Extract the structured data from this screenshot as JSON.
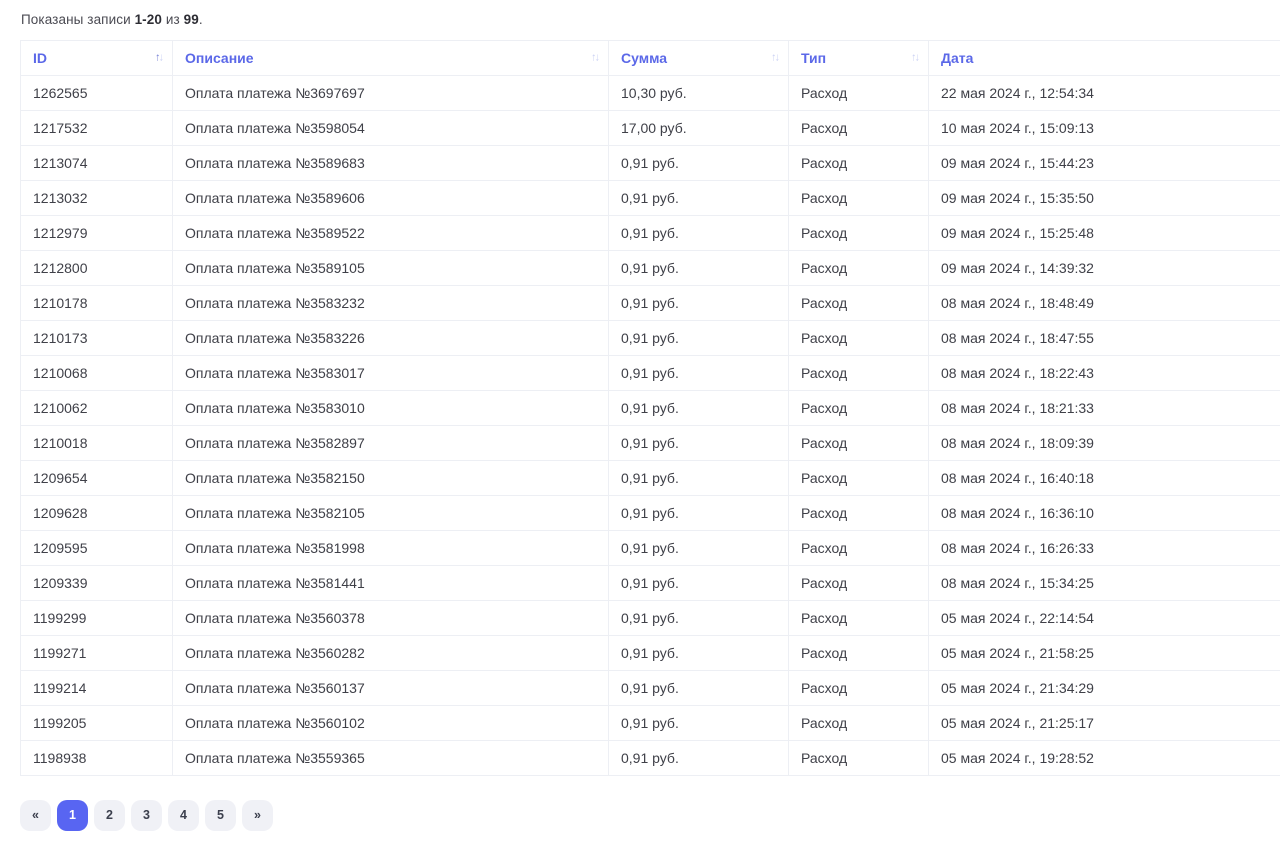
{
  "colors": {
    "accent_header_text": "#5b68e8",
    "active_page_bg": "#5865f2",
    "row_border": "#edeff4",
    "body_text": "#3f4048",
    "inactive_page_bg": "#f0f1f6"
  },
  "icons": {
    "sort_asc": "↑",
    "sort_desc": "↓"
  },
  "summary": {
    "prefix": "Показаны записи",
    "range": "1-20",
    "of_word": "из",
    "total": "99",
    "suffix": "."
  },
  "table": {
    "columns": [
      {
        "key": "id",
        "label": "ID",
        "sort": "asc"
      },
      {
        "key": "description",
        "label": "Описание",
        "sort": "none"
      },
      {
        "key": "amount",
        "label": "Сумма",
        "sort": "none"
      },
      {
        "key": "type",
        "label": "Тип",
        "sort": "none"
      },
      {
        "key": "date",
        "label": "Дата",
        "sort": "none"
      }
    ],
    "rows": [
      {
        "id": "1262565",
        "description": "Оплата платежа №3697697",
        "amount": "10,30 руб.",
        "type": "Расход",
        "date": "22 мая 2024 г., 12:54:34"
      },
      {
        "id": "1217532",
        "description": "Оплата платежа №3598054",
        "amount": "17,00 руб.",
        "type": "Расход",
        "date": "10 мая 2024 г., 15:09:13"
      },
      {
        "id": "1213074",
        "description": "Оплата платежа №3589683",
        "amount": "0,91 руб.",
        "type": "Расход",
        "date": "09 мая 2024 г., 15:44:23"
      },
      {
        "id": "1213032",
        "description": "Оплата платежа №3589606",
        "amount": "0,91 руб.",
        "type": "Расход",
        "date": "09 мая 2024 г., 15:35:50"
      },
      {
        "id": "1212979",
        "description": "Оплата платежа №3589522",
        "amount": "0,91 руб.",
        "type": "Расход",
        "date": "09 мая 2024 г., 15:25:48"
      },
      {
        "id": "1212800",
        "description": "Оплата платежа №3589105",
        "amount": "0,91 руб.",
        "type": "Расход",
        "date": "09 мая 2024 г., 14:39:32"
      },
      {
        "id": "1210178",
        "description": "Оплата платежа №3583232",
        "amount": "0,91 руб.",
        "type": "Расход",
        "date": "08 мая 2024 г., 18:48:49"
      },
      {
        "id": "1210173",
        "description": "Оплата платежа №3583226",
        "amount": "0,91 руб.",
        "type": "Расход",
        "date": "08 мая 2024 г., 18:47:55"
      },
      {
        "id": "1210068",
        "description": "Оплата платежа №3583017",
        "amount": "0,91 руб.",
        "type": "Расход",
        "date": "08 мая 2024 г., 18:22:43"
      },
      {
        "id": "1210062",
        "description": "Оплата платежа №3583010",
        "amount": "0,91 руб.",
        "type": "Расход",
        "date": "08 мая 2024 г., 18:21:33"
      },
      {
        "id": "1210018",
        "description": "Оплата платежа №3582897",
        "amount": "0,91 руб.",
        "type": "Расход",
        "date": "08 мая 2024 г., 18:09:39"
      },
      {
        "id": "1209654",
        "description": "Оплата платежа №3582150",
        "amount": "0,91 руб.",
        "type": "Расход",
        "date": "08 мая 2024 г., 16:40:18"
      },
      {
        "id": "1209628",
        "description": "Оплата платежа №3582105",
        "amount": "0,91 руб.",
        "type": "Расход",
        "date": "08 мая 2024 г., 16:36:10"
      },
      {
        "id": "1209595",
        "description": "Оплата платежа №3581998",
        "amount": "0,91 руб.",
        "type": "Расход",
        "date": "08 мая 2024 г., 16:26:33"
      },
      {
        "id": "1209339",
        "description": "Оплата платежа №3581441",
        "amount": "0,91 руб.",
        "type": "Расход",
        "date": "08 мая 2024 г., 15:34:25"
      },
      {
        "id": "1199299",
        "description": "Оплата платежа №3560378",
        "amount": "0,91 руб.",
        "type": "Расход",
        "date": "05 мая 2024 г., 22:14:54"
      },
      {
        "id": "1199271",
        "description": "Оплата платежа №3560282",
        "amount": "0,91 руб.",
        "type": "Расход",
        "date": "05 мая 2024 г., 21:58:25"
      },
      {
        "id": "1199214",
        "description": "Оплата платежа №3560137",
        "amount": "0,91 руб.",
        "type": "Расход",
        "date": "05 мая 2024 г., 21:34:29"
      },
      {
        "id": "1199205",
        "description": "Оплата платежа №3560102",
        "amount": "0,91 руб.",
        "type": "Расход",
        "date": "05 мая 2024 г., 21:25:17"
      },
      {
        "id": "1198938",
        "description": "Оплата платежа №3559365",
        "amount": "0,91 руб.",
        "type": "Расход",
        "date": "05 мая 2024 г., 19:28:52"
      }
    ]
  },
  "pagination": {
    "items": [
      {
        "label": "«",
        "name": "pagination-prev",
        "active": false
      },
      {
        "label": "1",
        "name": "pagination-page-1",
        "active": true
      },
      {
        "label": "2",
        "name": "pagination-page-2",
        "active": false
      },
      {
        "label": "3",
        "name": "pagination-page-3",
        "active": false
      },
      {
        "label": "4",
        "name": "pagination-page-4",
        "active": false
      },
      {
        "label": "5",
        "name": "pagination-page-5",
        "active": false
      },
      {
        "label": "»",
        "name": "pagination-next",
        "active": false
      }
    ]
  }
}
